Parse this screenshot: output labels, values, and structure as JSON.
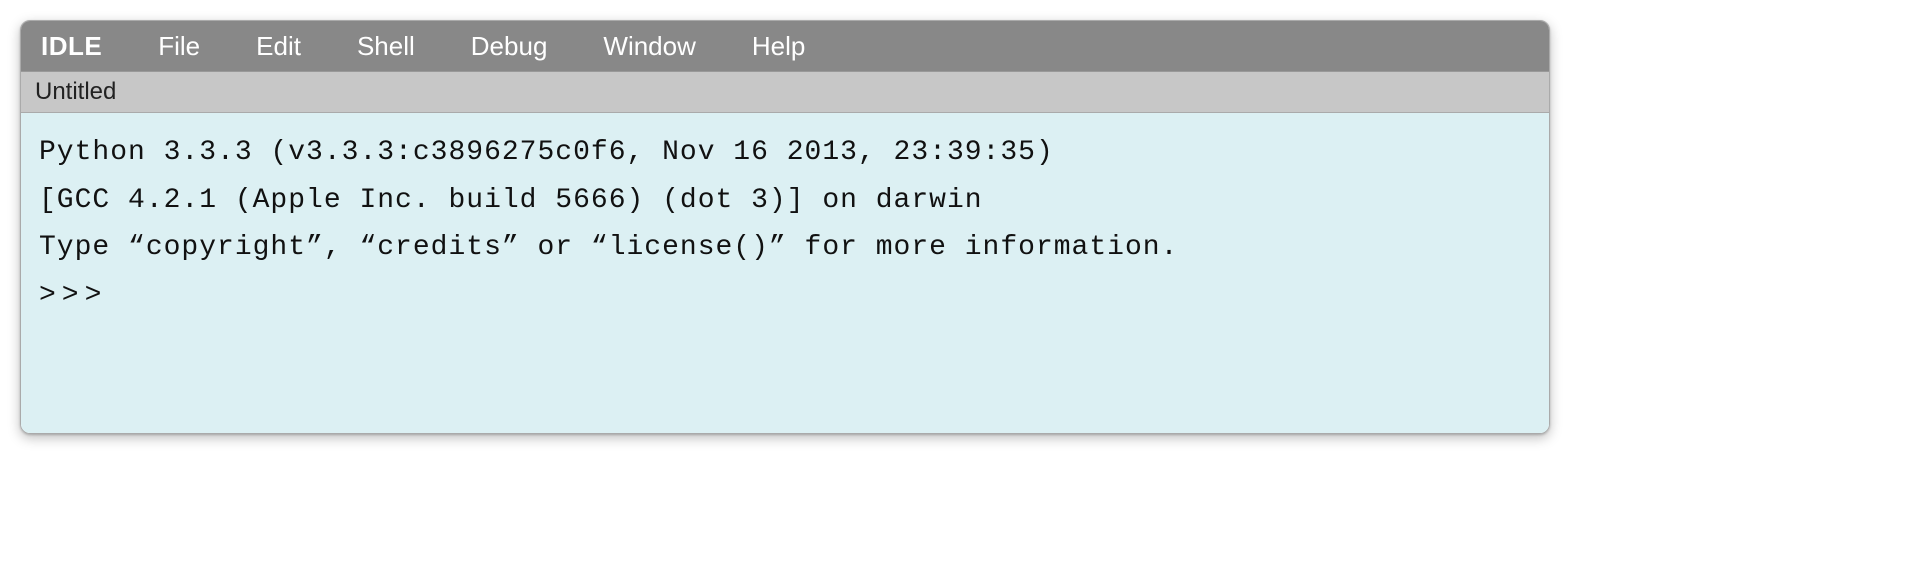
{
  "menubar": {
    "app": "IDLE",
    "items": [
      "File",
      "Edit",
      "Shell",
      "Debug",
      "Window",
      "Help"
    ]
  },
  "titlebar": {
    "title": "Untitled"
  },
  "shell": {
    "lines": [
      "Python 3.3.3 (v3.3.3:c3896275c0f6, Nov 16 2013, 23:39:35)",
      "[GCC 4.2.1 (Apple Inc. build 5666) (dot 3)] on darwin",
      "Type “copyright”, “credits” or “license()” for more information."
    ],
    "prompt": ">>>"
  }
}
